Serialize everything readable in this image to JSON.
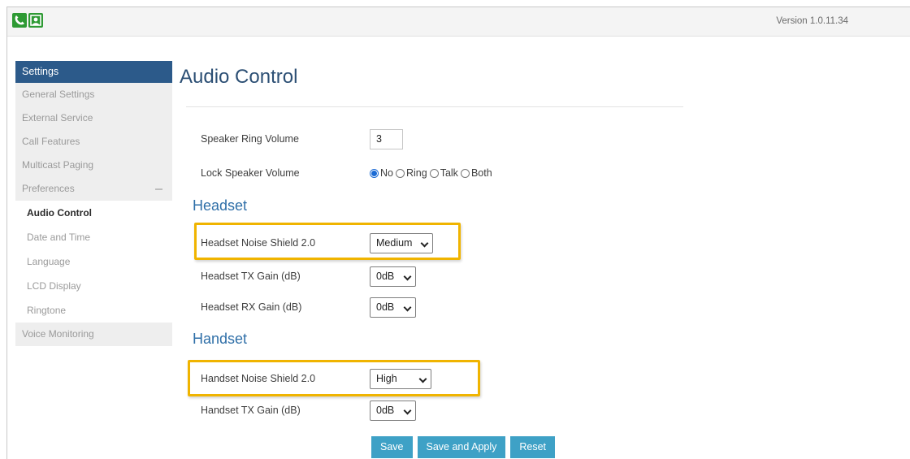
{
  "header": {
    "version_text": "Version 1.0.11.34",
    "logos": [
      {
        "icon": "phone-handset-icon",
        "color": "#2e9a34"
      },
      {
        "icon": "person-icon",
        "color": "#2e9a34"
      }
    ]
  },
  "sidebar": {
    "heading": "Settings",
    "items": [
      {
        "label": "General Settings",
        "level": 1
      },
      {
        "label": "External Service",
        "level": 1
      },
      {
        "label": "Call Features",
        "level": 1
      },
      {
        "label": "Multicast Paging",
        "level": 1
      },
      {
        "label": "Preferences",
        "level": 1,
        "expanded": true
      },
      {
        "label": "Audio Control",
        "level": 2,
        "active": true
      },
      {
        "label": "Date and Time",
        "level": 2
      },
      {
        "label": "Language",
        "level": 2
      },
      {
        "label": "LCD Display",
        "level": 2
      },
      {
        "label": "Ringtone",
        "level": 2
      },
      {
        "label": "Voice Monitoring",
        "level": 1
      }
    ]
  },
  "main": {
    "title": "Audio Control",
    "speaker_ring_volume": {
      "label": "Speaker Ring Volume",
      "value": "3"
    },
    "lock_speaker_volume": {
      "label": "Lock Speaker Volume",
      "options": [
        "No",
        "Ring",
        "Talk",
        "Both"
      ],
      "selected": "No"
    },
    "headset": {
      "title": "Headset",
      "noise_shield": {
        "label": "Headset Noise Shield 2.0",
        "value": "Medium"
      },
      "tx_gain": {
        "label": "Headset TX Gain (dB)",
        "value": "0dB"
      },
      "rx_gain": {
        "label": "Headset RX Gain (dB)",
        "value": "0dB"
      }
    },
    "handset": {
      "title": "Handset",
      "noise_shield": {
        "label": "Handset Noise Shield 2.0",
        "value": "High"
      },
      "tx_gain": {
        "label": "Handset TX Gain (dB)",
        "value": "0dB"
      }
    },
    "buttons": {
      "save": "Save",
      "save_apply": "Save and Apply",
      "reset": "Reset"
    }
  },
  "colors": {
    "sidebar_heading_bg": "#2c5a8a",
    "title": "#2c4f74",
    "section_title": "#2f6fa8",
    "button_bg": "#3ea1c6",
    "highlight_border": "#f0b400",
    "radio_selected": "#1a6ad4"
  }
}
